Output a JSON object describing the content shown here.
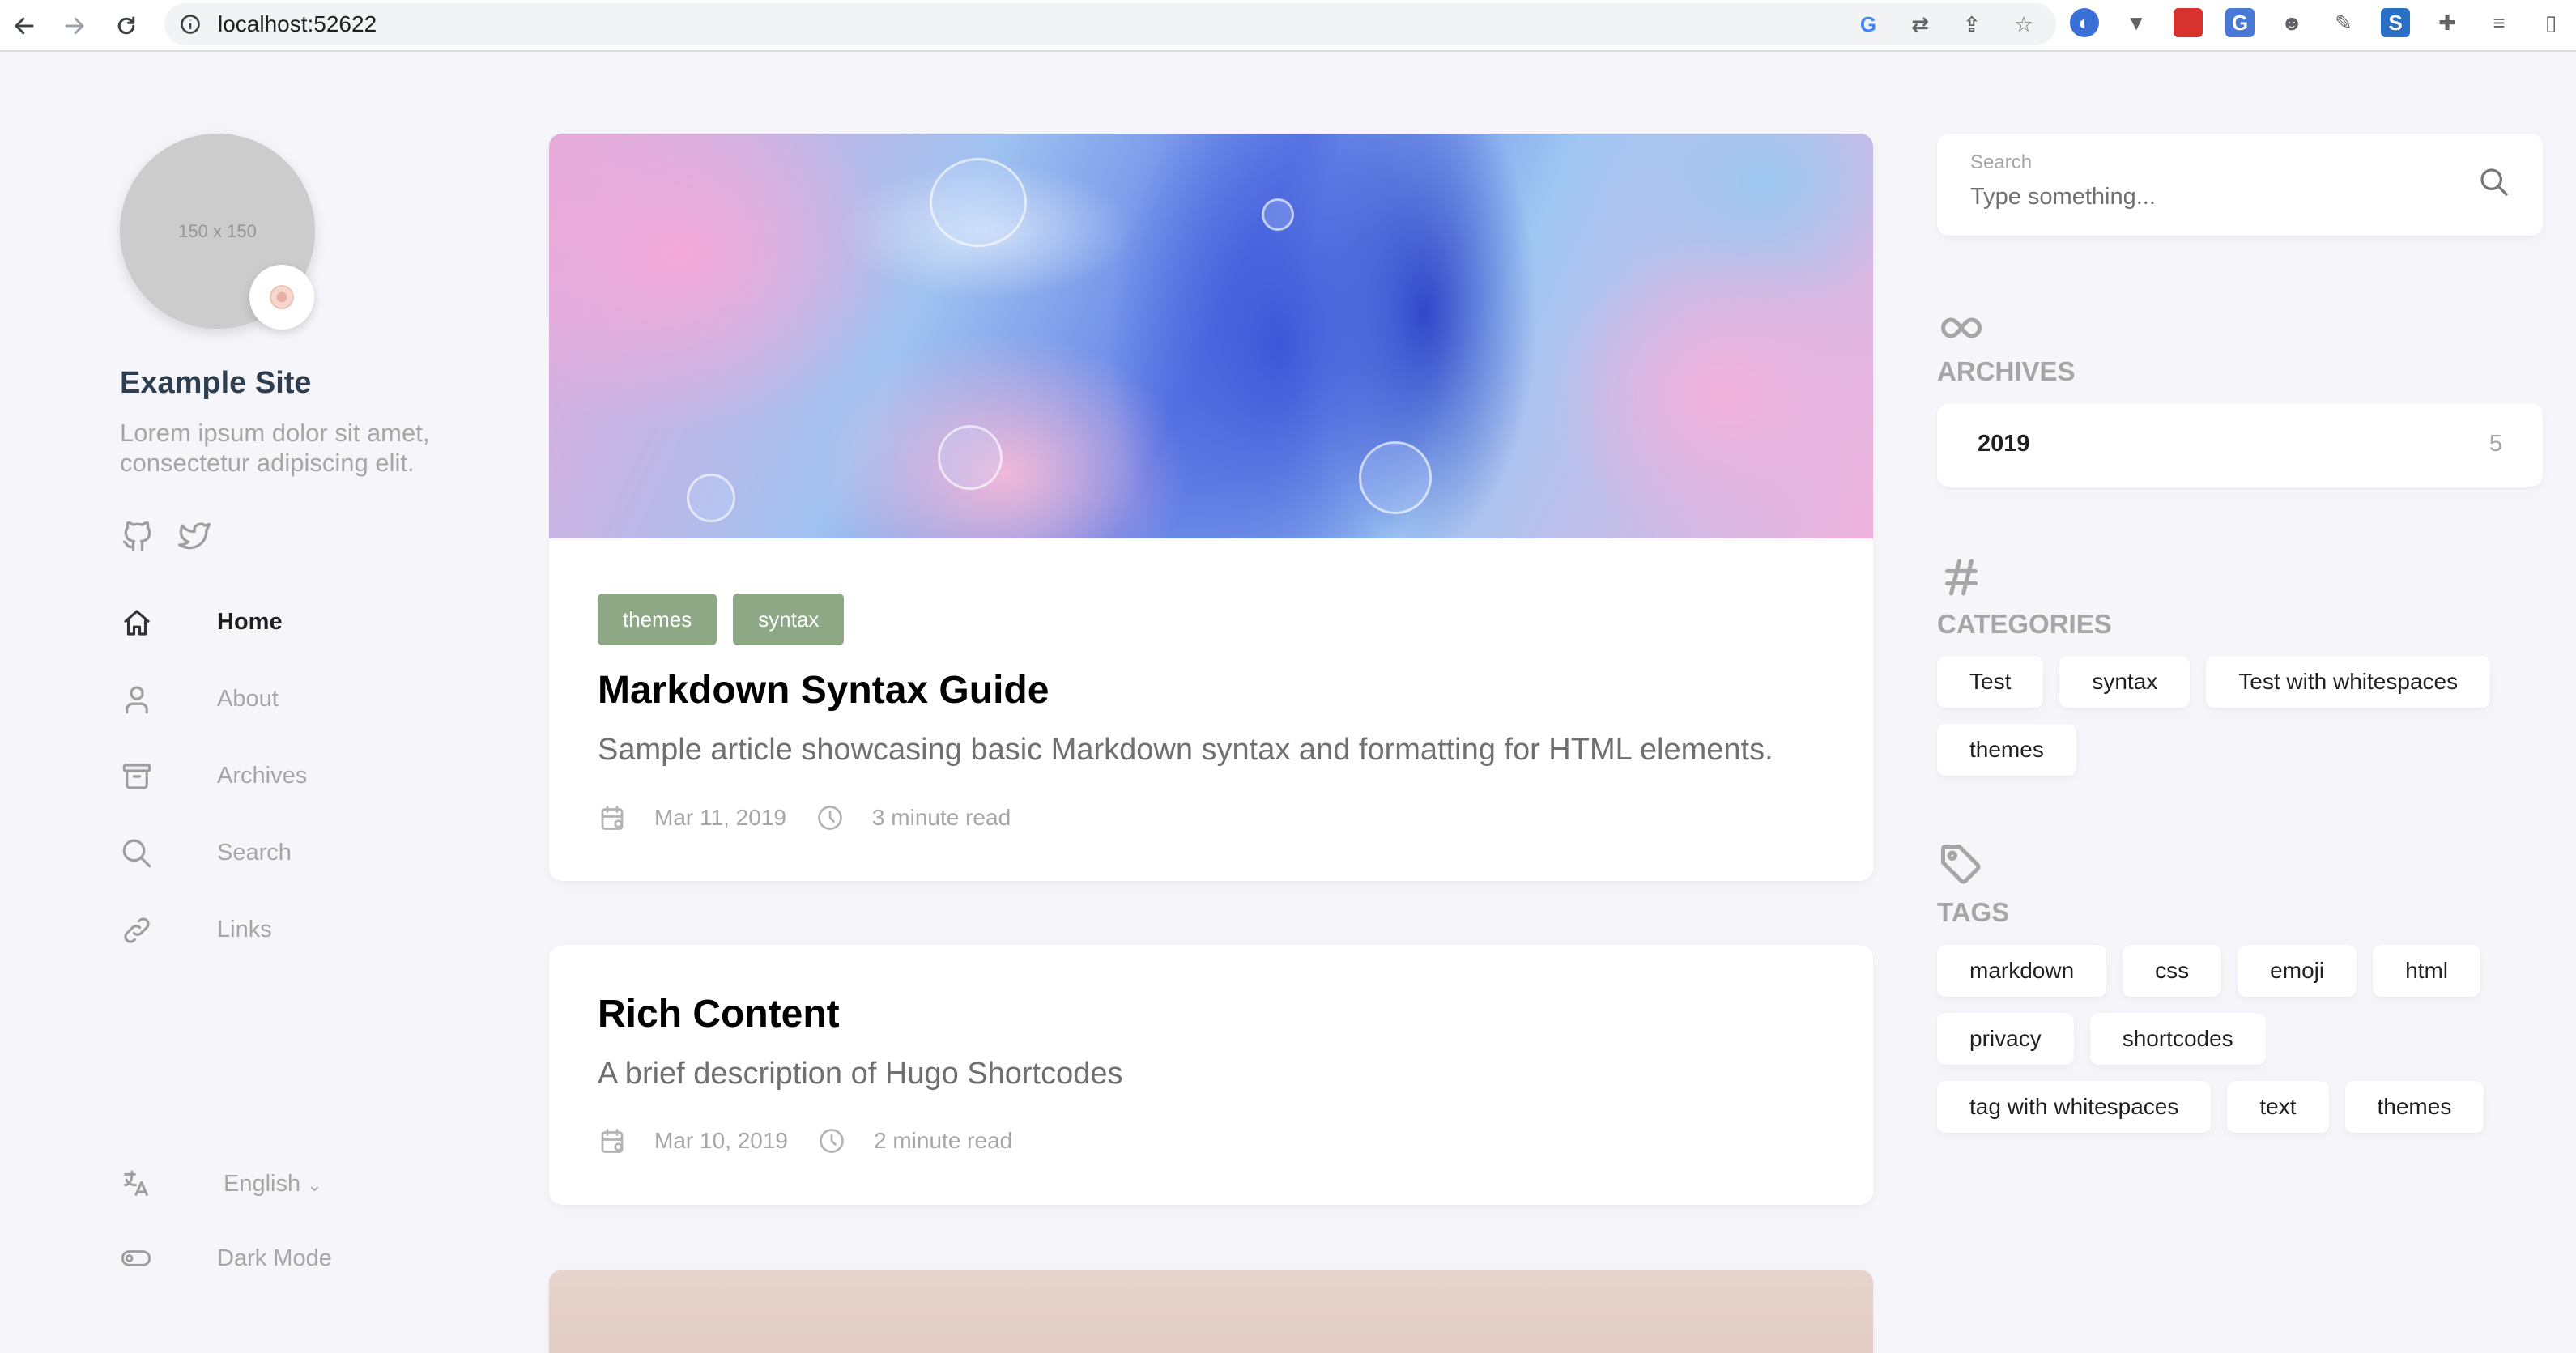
{
  "browser": {
    "url": "localhost:52622"
  },
  "sidebar": {
    "avatar_placeholder": "150 x 150",
    "site_title": "Example Site",
    "site_description": "Lorem ipsum dolor sit amet, consectetur adipiscing elit.",
    "social": [
      "github-icon",
      "twitter-icon"
    ],
    "menu": [
      {
        "label": "Home",
        "icon": "home-icon",
        "active": true
      },
      {
        "label": "About",
        "icon": "user-icon",
        "active": false
      },
      {
        "label": "Archives",
        "icon": "archive-icon",
        "active": false
      },
      {
        "label": "Search",
        "icon": "search-icon",
        "active": false
      },
      {
        "label": "Links",
        "icon": "link-icon",
        "active": false
      }
    ],
    "language": "English",
    "dark_mode_label": "Dark Mode"
  },
  "posts": [
    {
      "tags": [
        "themes",
        "syntax"
      ],
      "title": "Markdown Syntax Guide",
      "description": "Sample article showcasing basic Markdown syntax and formatting for HTML elements.",
      "date": "Mar 11, 2019",
      "read_time": "3 minute read"
    },
    {
      "title": "Rich Content",
      "description": "A brief description of Hugo Shortcodes",
      "date": "Mar 10, 2019",
      "read_time": "2 minute read"
    }
  ],
  "right": {
    "search": {
      "label": "Search",
      "placeholder": "Type something..."
    },
    "archives": {
      "title": "ARCHIVES",
      "items": [
        {
          "year": "2019",
          "count": "5"
        }
      ]
    },
    "categories": {
      "title": "CATEGORIES",
      "items": [
        "Test",
        "syntax",
        "Test with whitespaces",
        "themes"
      ]
    },
    "tags": {
      "title": "TAGS",
      "items": [
        "markdown",
        "css",
        "emoji",
        "html",
        "privacy",
        "shortcodes",
        "tag with whitespaces",
        "text",
        "themes"
      ]
    }
  },
  "colors": {
    "page_bg": "#f5f5fa",
    "tag_accent": "#8ea885",
    "text_muted": "#a6a6a6"
  }
}
